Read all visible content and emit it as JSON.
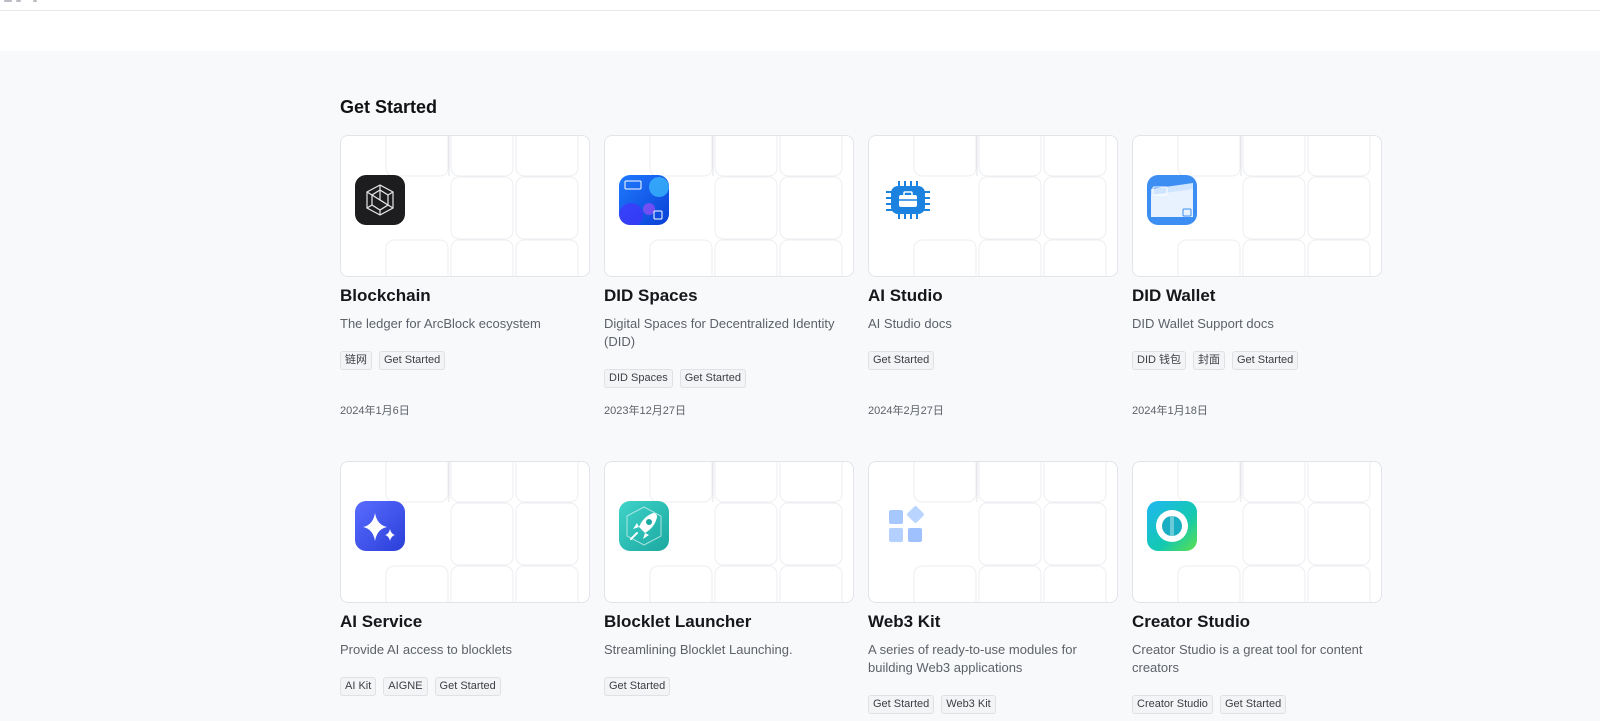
{
  "section": {
    "title": "Get Started"
  },
  "cards": [
    {
      "title": "Blockchain",
      "description": "The ledger for ArcBlock ecosystem",
      "tags": [
        "链网",
        "Get Started"
      ],
      "date": "2024年1月6日",
      "icon": "blockchain-cube-icon"
    },
    {
      "title": "DID Spaces",
      "description": "Digital Spaces for Decentralized Identity (DID)",
      "tags": [
        "DID Spaces",
        "Get Started"
      ],
      "date": "2023年12月27日",
      "icon": "did-spaces-icon"
    },
    {
      "title": "AI Studio",
      "description": "AI Studio docs",
      "tags": [
        "Get Started"
      ],
      "date": "2024年2月27日",
      "icon": "ai-studio-chip-icon"
    },
    {
      "title": "DID Wallet",
      "description": "DID Wallet Support docs",
      "tags": [
        "DID 钱包",
        "封面",
        "Get Started"
      ],
      "date": "2024年1月18日",
      "icon": "did-wallet-icon"
    },
    {
      "title": "AI Service",
      "description": "Provide AI access to blocklets",
      "tags": [
        "AI Kit",
        "AIGNE",
        "Get Started"
      ],
      "date": "",
      "icon": "ai-service-sparkle-icon"
    },
    {
      "title": "Blocklet Launcher",
      "description": "Streamlining Blocklet Launching.",
      "tags": [
        "Get Started"
      ],
      "date": "",
      "icon": "blocklet-launcher-rocket-icon"
    },
    {
      "title": "Web3 Kit",
      "description": "A series of ready-to-use modules for building Web3 applications",
      "tags": [
        "Get Started",
        "Web3 Kit"
      ],
      "date": "",
      "icon": "web3-kit-blocks-icon"
    },
    {
      "title": "Creator Studio",
      "description": "Creator Studio is a great tool for content creators",
      "tags": [
        "Creator Studio",
        "Get Started"
      ],
      "date": "",
      "icon": "creator-studio-ring-icon"
    }
  ],
  "colors": {
    "background": "#f8f9fb",
    "card_border": "#e3e5e8",
    "tag_bg": "#f3f4f6",
    "text_secondary": "#5d6168"
  }
}
